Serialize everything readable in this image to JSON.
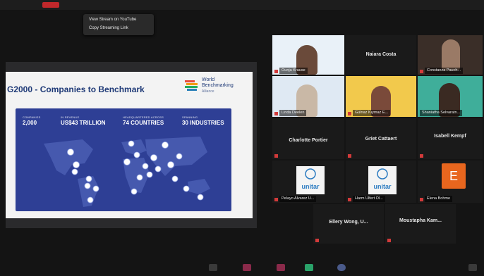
{
  "context_menu": {
    "items": [
      "View Stream on YouTube",
      "Copy Streaming Link"
    ]
  },
  "slide": {
    "title": "G2000 - Companies to Benchmark",
    "logo_lines": [
      "World",
      "Benchmarking",
      "Alliance"
    ],
    "stats": [
      {
        "label": "COMPANIES",
        "value": "2,000"
      },
      {
        "label": "IN REVENUE",
        "value": "US$43 TRILLION"
      },
      {
        "label": "HEADQUARTERED ACROSS",
        "value": "74 COUNTRIES"
      },
      {
        "label": "SPANNING",
        "value": "30 INDUSTRIES"
      }
    ]
  },
  "participants": [
    {
      "name": "Ounja Krause",
      "kind": "video"
    },
    {
      "name": "Naiara Costa",
      "kind": "name"
    },
    {
      "name": "Constanza Pauch...",
      "kind": "video"
    },
    {
      "name": "Linda Deelen",
      "kind": "video"
    },
    {
      "name": "Gülnaz Kıymaz E...",
      "kind": "video"
    },
    {
      "name": "Shaniatha Selvaratn...",
      "kind": "video"
    },
    {
      "name": "Charlotte Portier",
      "kind": "name"
    },
    {
      "name": "Griet Cattaert",
      "kind": "name"
    },
    {
      "name": "Isabell Kempf",
      "kind": "name"
    },
    {
      "name": "Pelayo Alvarez U...",
      "kind": "logo"
    },
    {
      "name": "Harm Ulfert Ol...",
      "kind": "logo"
    },
    {
      "name": "Elena Bohme",
      "kind": "initial",
      "initial": "E"
    },
    {
      "name": "Ellery Wong, U...",
      "kind": "name"
    },
    {
      "name": "Moustapha Kam...",
      "kind": "name"
    }
  ],
  "unitar_label": "unitar",
  "colors": {
    "map_blue": "#2e3f95",
    "title_blue": "#1f3a77",
    "avatar_orange": "#e8661e",
    "mute_red": "#d23a3a"
  }
}
